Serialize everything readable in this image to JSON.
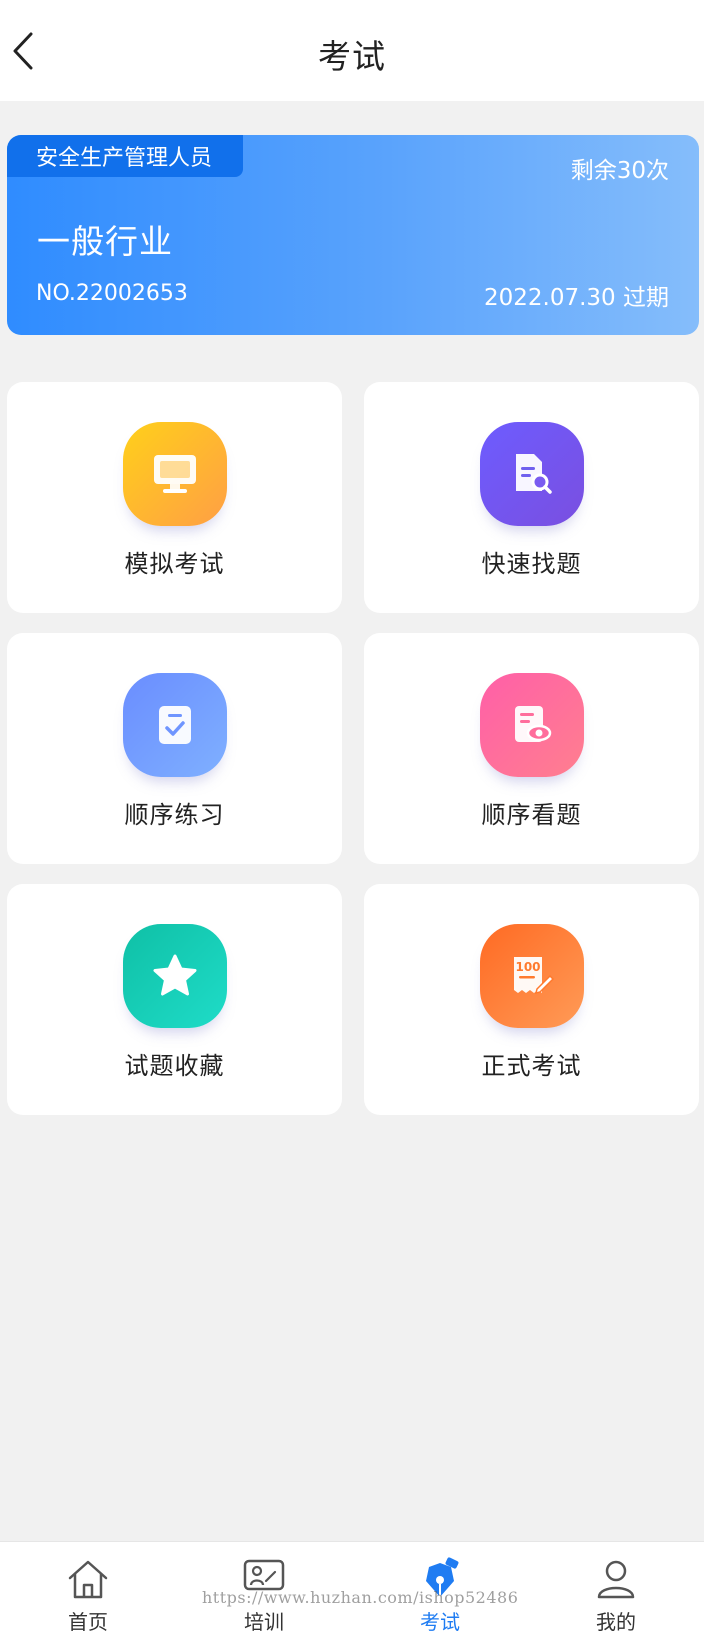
{
  "header": {
    "title": "考试",
    "back_icon": "chevron-left-icon"
  },
  "cert": {
    "role": "安全生产管理人员",
    "remaining": "剩余30次",
    "industry": "一般行业",
    "number": "NO.22002653",
    "expiry": "2022.07.30 过期",
    "colors": {
      "start": "#2f8cff",
      "end": "#85bdfb",
      "tag": "#1170eb"
    }
  },
  "tiles": [
    {
      "label": "模拟考试",
      "icon": "monitor-icon"
    },
    {
      "label": "快速找题",
      "icon": "document-search-icon"
    },
    {
      "label": "顺序练习",
      "icon": "checklist-icon"
    },
    {
      "label": "顺序看题",
      "icon": "document-eye-icon"
    },
    {
      "label": "试题收藏",
      "icon": "star-icon"
    },
    {
      "label": "正式考试",
      "icon": "exam-score-icon"
    }
  ],
  "nav": {
    "items": [
      {
        "label": "首页",
        "icon": "home-icon"
      },
      {
        "label": "培训",
        "icon": "training-icon"
      },
      {
        "label": "考试",
        "icon": "pen-nib-icon",
        "active": true
      },
      {
        "label": "我的",
        "icon": "user-icon"
      }
    ],
    "active_color": "#1f7cf2"
  },
  "watermark": "https://www.huzhan.com/ishop52486"
}
